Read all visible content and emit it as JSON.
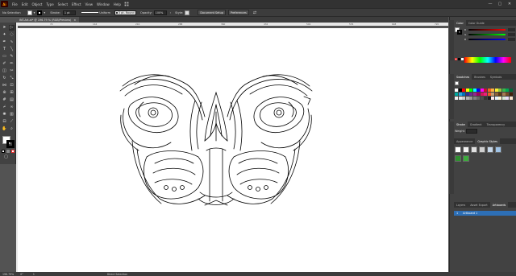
{
  "app": {
    "logo": "Ai"
  },
  "menu": [
    "File",
    "Edit",
    "Object",
    "Type",
    "Select",
    "Effect",
    "View",
    "Window",
    "Help"
  ],
  "window_controls": [
    "—",
    "▢",
    "✕"
  ],
  "control_bar": {
    "selection": "No Selection",
    "stroke_label": "Stroke:",
    "stroke_weight": "1 pt",
    "brush": "Uniform",
    "brush_size": "3 pt. Round",
    "opacity_label": "Opacity:",
    "opacity_value": "100%",
    "style_label": "Style:",
    "doc_setup": "Document Setup",
    "preferences": "Preferences"
  },
  "document_tab": {
    "title": "INT-Art.ai* @ 196.79 % (RGB/Preview)",
    "close": "×"
  },
  "ruler_marks": [
    "72",
    "144",
    "216",
    "288",
    "360",
    "432",
    "504",
    "576",
    "648",
    "720"
  ],
  "status_bar": {
    "zoom": "196.79%",
    "angle": "0°",
    "artboard": "1",
    "tool": "Direct Selection"
  },
  "panels": {
    "color": {
      "tabs": [
        "Color",
        "Color Guide"
      ],
      "channels": [
        "R",
        "G",
        "B"
      ]
    },
    "swatches": {
      "tabs": [
        "Swatches",
        "Brushes",
        "Symbols"
      ]
    },
    "stroke": {
      "tabs": [
        "Stroke",
        "Gradient",
        "Transparency"
      ],
      "weight_label": "Weight:"
    },
    "appearance": {
      "tabs": [
        "Appearance",
        "Graphic Styles"
      ]
    },
    "layers": {
      "tabs": [
        "Layers",
        "Asset Export",
        "Artboards"
      ],
      "artboard_number": "1",
      "artboard_name": "Artboard 1"
    }
  },
  "colors": {
    "chrome_dark": "#323232",
    "chrome_mid": "#424242",
    "canvas": "#535353",
    "artboard": "#ffffff",
    "accent_blue": "#2d6fb6",
    "logo_orange": "#ff9a00"
  },
  "swatch_colors": [
    "#ffffff",
    "#000000",
    "#ff0000",
    "#ffff00",
    "#00ff00",
    "#00ffff",
    "#0000ff",
    "#ff00ff",
    "#c8102e",
    "#f26522",
    "#fbb040",
    "#f9ed32",
    "#8dc63f",
    "#39b54a",
    "#00a651",
    "#006838",
    "#00a99d",
    "#29abe2",
    "#0072bc",
    "#2e3192",
    "#662d91",
    "#92278f",
    "#9e005d",
    "#d4145a",
    "#ed1e79",
    "#f15a24",
    "#c69c6d",
    "#8c6239",
    "#603813",
    "#a67c52",
    "#754c24",
    "#42210b",
    "#f2f2f2",
    "#e6e6e6",
    "#cccccc",
    "#b3b3b3",
    "#999999",
    "#808080",
    "#666666",
    "#4d4d4d",
    "#333333",
    "#1a1a1a",
    "#ffe6e6",
    "#e6f2ff",
    "#fff2cc",
    "#d9ead3",
    "#eadcf8",
    "#fce5cd"
  ]
}
